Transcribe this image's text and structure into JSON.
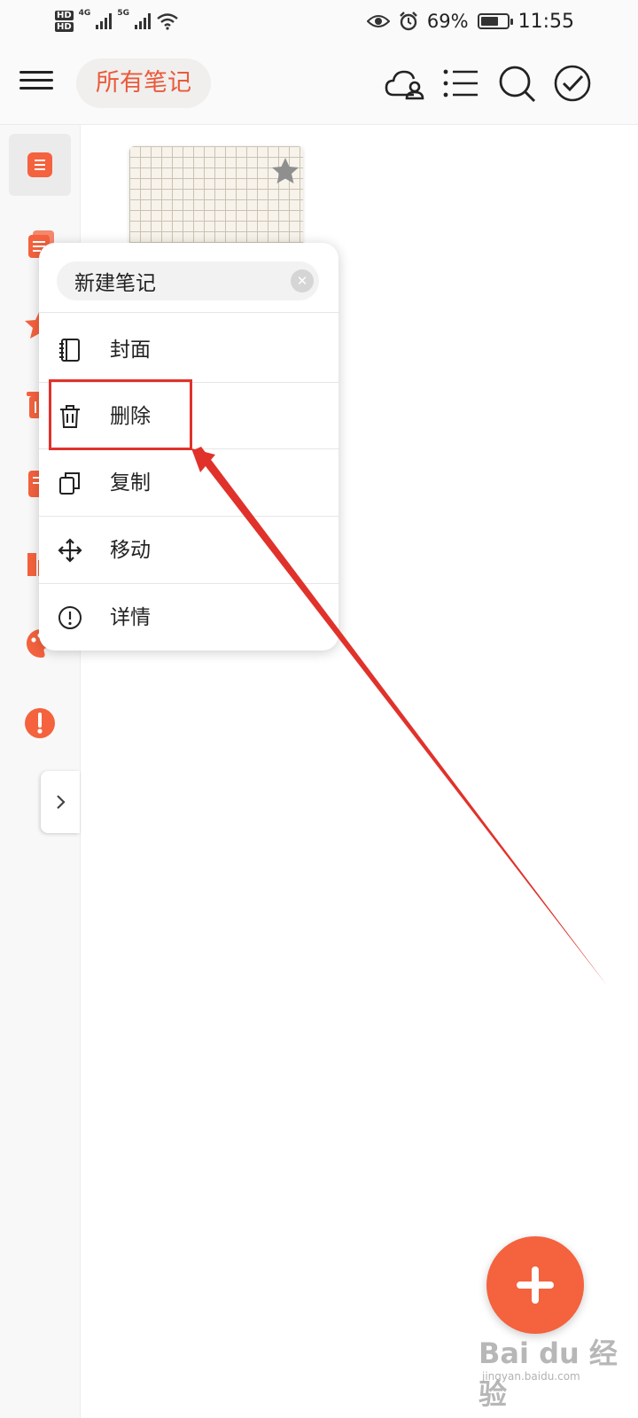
{
  "status_bar": {
    "hd1": "HD",
    "hd2": "HD",
    "network1": "4G",
    "network2": "5G",
    "battery_level": 0.69,
    "battery_percent": "69%",
    "time": "11:55",
    "icons": [
      "eye-icon",
      "alarm-icon",
      "battery-icon",
      "wifi-icon",
      "signal-icon"
    ]
  },
  "header": {
    "title": "所有笔记",
    "icons": [
      "menu-icon",
      "cloud-user-icon",
      "list-icon",
      "search-icon",
      "check-circle-icon"
    ]
  },
  "sidebar": {
    "items": [
      {
        "icon": "all-notes-icon",
        "active": true
      },
      {
        "icon": "notes-icon"
      },
      {
        "icon": "star-icon"
      },
      {
        "icon": "trash-icon"
      },
      {
        "icon": "note-icon"
      },
      {
        "icon": "book-icon"
      },
      {
        "icon": "palette-icon"
      },
      {
        "icon": "info-icon"
      }
    ],
    "expand_icon": "chevron-right-icon"
  },
  "note_card": {
    "favorite_icon": "star-icon"
  },
  "context_menu": {
    "name_value": "新建笔记",
    "clear_icon": "close-icon",
    "items": [
      {
        "label": "封面",
        "icon": "cover-icon"
      },
      {
        "label": "删除",
        "icon": "trash-icon"
      },
      {
        "label": "复制",
        "icon": "copy-icon"
      },
      {
        "label": "移动",
        "icon": "move-icon"
      },
      {
        "label": "详情",
        "icon": "info-icon"
      }
    ]
  },
  "fab": {
    "icon": "plus-icon"
  },
  "watermark": {
    "text": "Bai du 经验",
    "sub": "jingyan.baidu.com"
  },
  "colors": {
    "accent": "#f4623e",
    "title_text": "#ea5a3a",
    "highlight": "#e0322b"
  }
}
